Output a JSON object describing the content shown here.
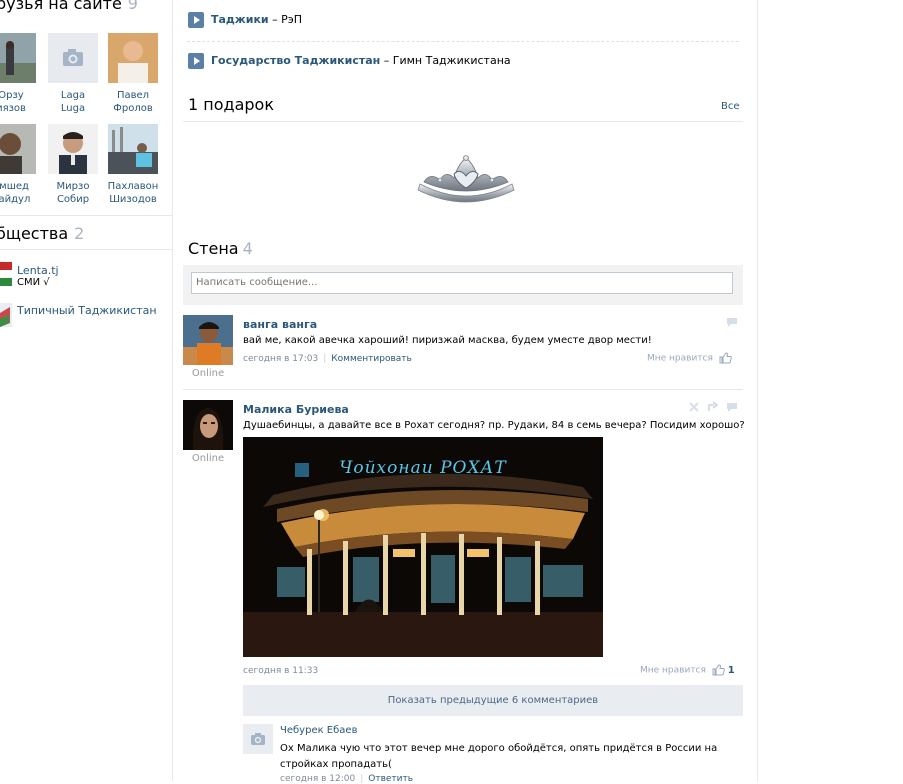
{
  "left": {
    "friends_online_title": "рузья на сайте",
    "friends_online_count": "9",
    "friends": [
      {
        "first": "Орзу",
        "last": "иязов"
      },
      {
        "first": "Laga",
        "last": "Luga"
      },
      {
        "first": "Павел",
        "last": "Фролов"
      },
      {
        "first": "амшед",
        "last": "Байдул"
      },
      {
        "first": "Мирзо",
        "last": "Собир"
      },
      {
        "first": "Пахлавон",
        "last": "Шизодов"
      }
    ],
    "communities_title": "бщества",
    "communities_count": "2",
    "communities": [
      {
        "name": "Lenta.tj",
        "sub": "СМИ √"
      },
      {
        "name": "Типичный Таджикистан",
        "sub": ""
      }
    ]
  },
  "audio": [
    {
      "artist": "Таджики",
      "title": "РэП"
    },
    {
      "artist": "Государство Таджикистан",
      "title": "Гимн Таджикистана"
    }
  ],
  "audio_dash": " – ",
  "gifts": {
    "title": "1 подарок",
    "all_label": "Все",
    "icon": "tiara-icon"
  },
  "wall": {
    "title": "Стена",
    "count": "4",
    "input_placeholder": "Написать сообщение...",
    "posts": [
      {
        "author": "ванга ванга",
        "text": "вай ме, какой авечка хароший! пиризжай масква, будем уместе двор мести!",
        "time": "сегодня в 17:03",
        "action": "Комментировать",
        "like_label": "Мне нравится",
        "like_count": "",
        "status": "Online"
      },
      {
        "author": "Малика Буриева",
        "text": "Душаебинцы, а давайте все в Рохат сегодня? пр. Рудаки, 84 в семь вечера? Посидим хорошо?",
        "time": "сегодня в 11:33",
        "like_label": "Мне нравится",
        "like_count": "1",
        "status": "Online",
        "photo_sign": "Чойхонаи  РОХАТ"
      }
    ],
    "show_prev_label": "Показать предыдущие 6 комментариев",
    "reply": {
      "author": "Чебурек Ебаев",
      "text": "Ох Малика чую что этот вечер мне дорого обойдётся, опять придётся в России на стройках пропадать(",
      "time": "сегодня в 12:00",
      "action": "Ответить"
    }
  },
  "colors": {
    "link": "#2B587A",
    "counter": "#AAB4C1",
    "border": "#E7E8EC",
    "button_bg": "#E9ECF0"
  }
}
